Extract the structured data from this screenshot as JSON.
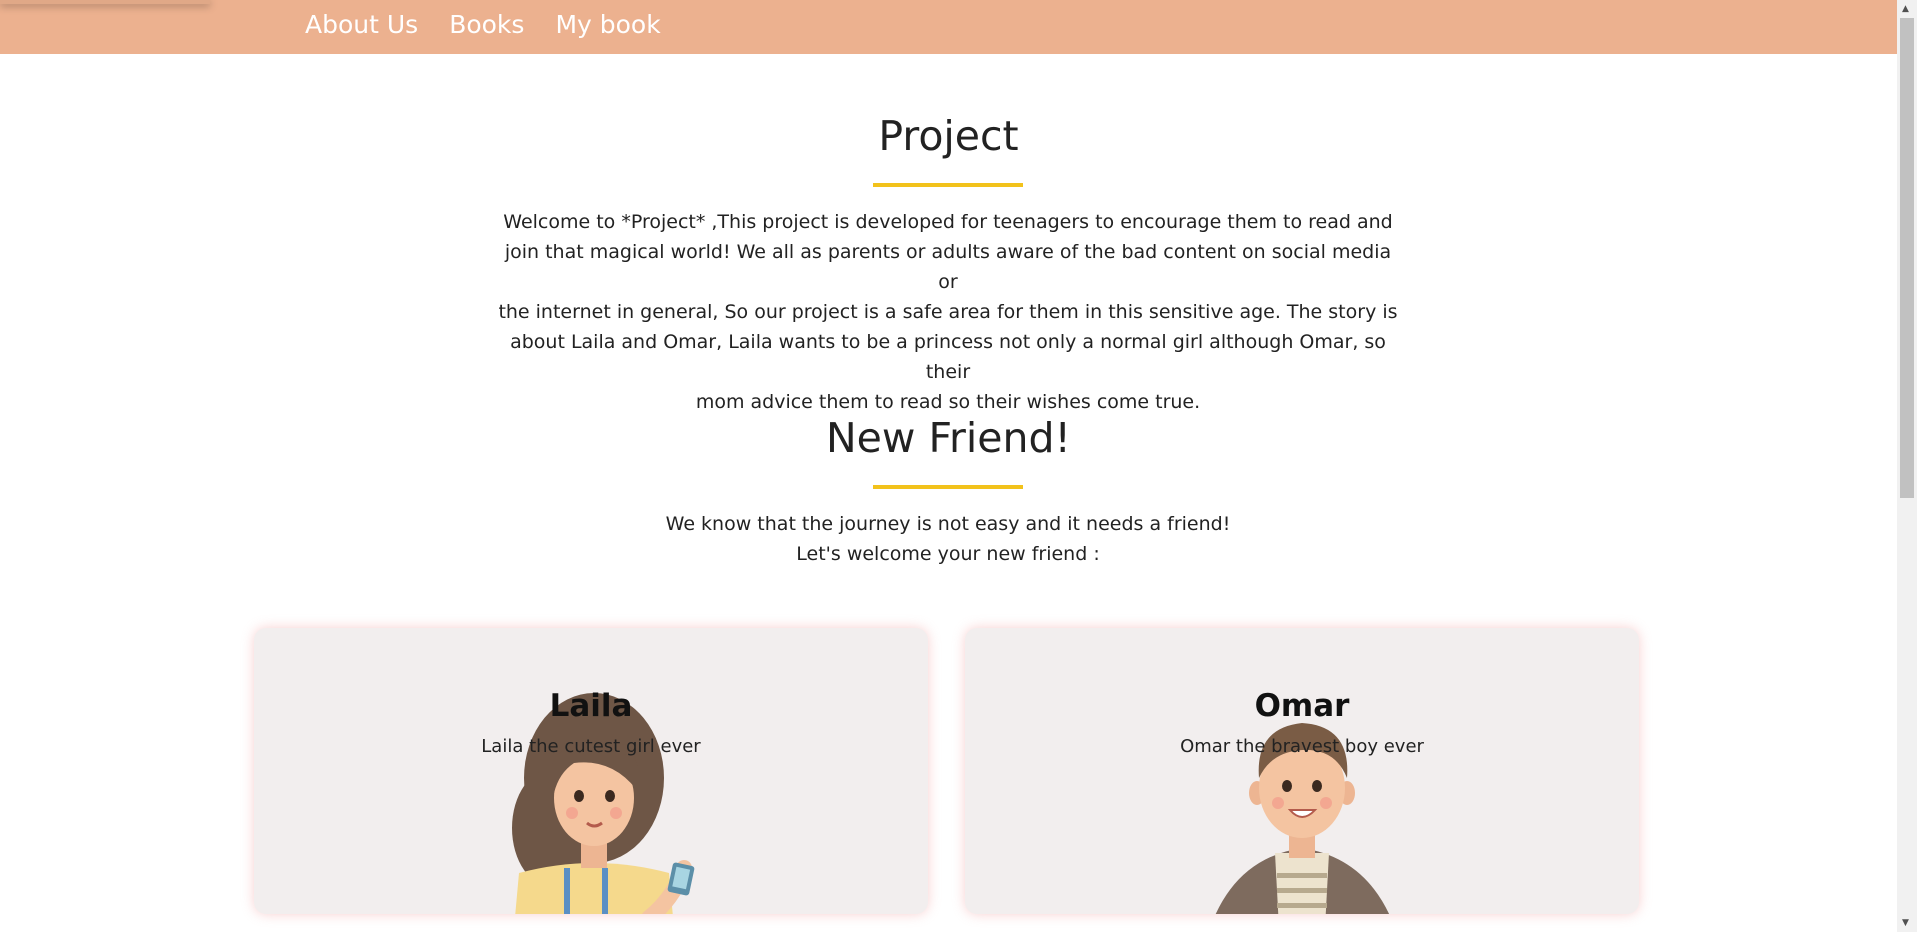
{
  "nav": {
    "links": [
      "About Us",
      "Books",
      "My book"
    ]
  },
  "project": {
    "title": "Project",
    "lines": [
      "Welcome to *Project* ,This project is developed for teenagers to encourage them to read and",
      "join that magical world! We all as parents or adults aware of the bad content on social media or",
      "the internet in general, So our project is a safe area for them in this sensitive age. The story is",
      "about Laila and Omar, Laila wants to be a princess not only a normal girl although Omar, so their",
      "mom advice them to read so their wishes come true."
    ]
  },
  "friend": {
    "title": "New Friend!",
    "lines": [
      "We know that the journey is not easy and it needs a friend!",
      "Let's welcome your new friend :"
    ]
  },
  "cards": [
    {
      "name": "Laila",
      "text": "Laila the cutest girl ever",
      "icon": "girl-illustration"
    },
    {
      "name": "Omar",
      "text": "Omar the bravest boy ever",
      "icon": "boy-illustration"
    }
  ],
  "colors": {
    "navbar": "#ECB18F",
    "underline": "#F2C21B",
    "card_background": "#F2EEEE"
  }
}
